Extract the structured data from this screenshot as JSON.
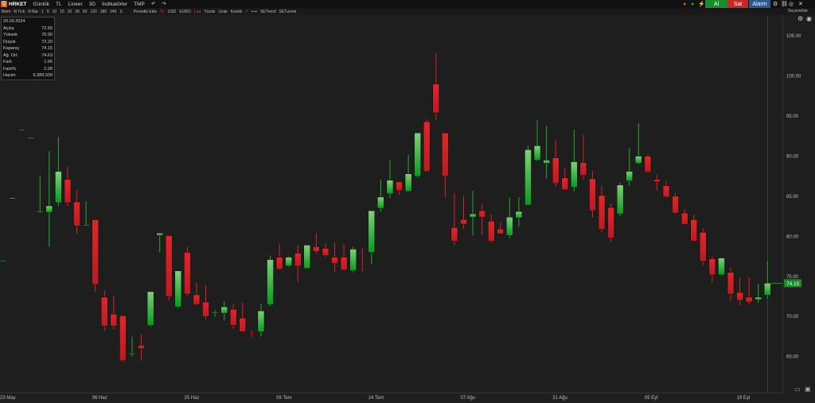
{
  "symbol": "HRKET",
  "toolbar": {
    "items": [
      "Günlük",
      "TL",
      "Lineer",
      "3D",
      "İndikatörler",
      "TMP"
    ],
    "sub_items": [
      "Birim",
      "N Tick",
      "N Bar",
      "1",
      "5",
      "10",
      "15",
      "20",
      "30",
      "60",
      "120",
      "180",
      "240",
      "S",
      "Periodik Ekle",
      "TL",
      "USD",
      "EURO",
      "Lira",
      "Yüzde",
      "Uzak",
      "Kesikli",
      "SETrend",
      "SETunnel"
    ],
    "buy": "Al",
    "sell": "Sat",
    "alarm": "Alarm",
    "right_label": "Seçenekler"
  },
  "info": {
    "date": "20.09.2024",
    "rows": [
      {
        "label": "Açılış",
        "value": "72.65"
      },
      {
        "label": "Yüksek",
        "value": "76.90"
      },
      {
        "label": "Düşük",
        "value": "72.20"
      },
      {
        "label": "Kapanış",
        "value": "74.15"
      },
      {
        "label": "Ağ. Ort",
        "value": "74.63"
      },
      {
        "label": "Fark",
        "value": "1.65"
      },
      {
        "label": "Fark%",
        "value": "2.28"
      },
      {
        "label": "Hacim",
        "value": "6,389,939"
      }
    ]
  },
  "colors": {
    "up": "#1fae2c",
    "down": "#d8232a",
    "bg": "#1e1e1e",
    "price_tag": "#1a8c2e"
  },
  "chart_data": {
    "type": "candlestick",
    "ylim": [
      60.5,
      107.5
    ],
    "y_ticks": [
      "105.00",
      "100.00",
      "95.00",
      "90.00",
      "85.00",
      "80.00",
      "75.00",
      "70.00",
      "65.00"
    ],
    "y_tick_values": [
      105,
      100,
      95,
      90,
      85,
      80,
      75,
      70,
      65
    ],
    "x_tick_labels": [
      "23 May",
      "06 Haz",
      "25 Haz",
      "09 Tem",
      "24 Tem",
      "07 Ağu",
      "21 Ağu",
      "05 Eyl",
      "19 Eyl"
    ],
    "x_tick_index": [
      0,
      10,
      20,
      30,
      40,
      50,
      60,
      70,
      80
    ],
    "last_price": "74.15",
    "candles": [
      {
        "o": 77.0,
        "h": 77.0,
        "l": 77.0,
        "c": 77.0
      },
      {
        "o": 84.8,
        "h": 84.8,
        "l": 84.8,
        "c": 84.8
      },
      {
        "o": 93.3,
        "h": 93.3,
        "l": 93.3,
        "c": 93.3
      },
      {
        "o": 92.3,
        "h": 92.3,
        "l": 92.3,
        "c": 92.3
      },
      {
        "o": 83.1,
        "h": 87.6,
        "l": 83.0,
        "c": 83.1
      },
      {
        "o": 83.0,
        "h": 90.6,
        "l": 78.7,
        "c": 83.8
      },
      {
        "o": 84.2,
        "h": 92.4,
        "l": 83.8,
        "c": 88.1
      },
      {
        "o": 87.1,
        "h": 88.7,
        "l": 83.8,
        "c": 84.2
      },
      {
        "o": 84.3,
        "h": 85.8,
        "l": 80.3,
        "c": 81.3
      },
      {
        "o": 81.4,
        "h": 84.4,
        "l": 81.3,
        "c": 81.4
      },
      {
        "o": 82.1,
        "h": 82.1,
        "l": 73.1,
        "c": 74.0
      },
      {
        "o": 72.4,
        "h": 73.3,
        "l": 68.2,
        "c": 68.8
      },
      {
        "o": 70.3,
        "h": 72.6,
        "l": 68.4,
        "c": 68.8
      },
      {
        "o": 70.1,
        "h": 70.1,
        "l": 64.4,
        "c": 64.5
      },
      {
        "o": 65.4,
        "h": 67.5,
        "l": 65.0,
        "c": 65.4
      },
      {
        "o": 66.4,
        "h": 67.8,
        "l": 64.5,
        "c": 66.0
      },
      {
        "o": 68.9,
        "h": 73.1,
        "l": 68.7,
        "c": 73.1
      },
      {
        "o": 80.1,
        "h": 80.3,
        "l": 78.0,
        "c": 80.4
      },
      {
        "o": 80.1,
        "h": 80.1,
        "l": 72.0,
        "c": 72.5
      },
      {
        "o": 71.2,
        "h": 75.7,
        "l": 71.0,
        "c": 75.7
      },
      {
        "o": 78.0,
        "h": 78.7,
        "l": 72.6,
        "c": 72.8
      },
      {
        "o": 72.7,
        "h": 74.2,
        "l": 71.5,
        "c": 71.5
      },
      {
        "o": 71.8,
        "h": 73.9,
        "l": 69.7,
        "c": 70.0
      },
      {
        "o": 70.4,
        "h": 70.8,
        "l": 70.0,
        "c": 70.5
      },
      {
        "o": 70.4,
        "h": 71.9,
        "l": 69.5,
        "c": 71.2
      },
      {
        "o": 70.9,
        "h": 71.5,
        "l": 68.5,
        "c": 68.9
      },
      {
        "o": 69.8,
        "h": 71.7,
        "l": 68.4,
        "c": 68.1
      },
      {
        "o": 67.9,
        "h": 68.3,
        "l": 67.4,
        "c": 67.8
      },
      {
        "o": 68.1,
        "h": 71.6,
        "l": 67.5,
        "c": 70.7
      },
      {
        "o": 71.5,
        "h": 77.6,
        "l": 71.3,
        "c": 77.1
      },
      {
        "o": 77.4,
        "h": 79.1,
        "l": 75.8,
        "c": 75.9
      },
      {
        "o": 76.3,
        "h": 77.5,
        "l": 76.2,
        "c": 77.4
      },
      {
        "o": 77.9,
        "h": 78.9,
        "l": 74.3,
        "c": 76.3
      },
      {
        "o": 76.0,
        "h": 78.9,
        "l": 76.0,
        "c": 78.9
      },
      {
        "o": 78.7,
        "h": 80.4,
        "l": 77.8,
        "c": 78.1
      },
      {
        "o": 78.5,
        "h": 79.1,
        "l": 77.4,
        "c": 77.6
      },
      {
        "o": 77.4,
        "h": 79.2,
        "l": 75.5,
        "c": 76.6
      },
      {
        "o": 77.4,
        "h": 79.0,
        "l": 75.9,
        "c": 75.8
      },
      {
        "o": 75.7,
        "h": 78.7,
        "l": 75.5,
        "c": 78.4
      },
      {
        "o": 76.1,
        "h": 78.5,
        "l": 75.6,
        "c": 76.0
      },
      {
        "o": 78.0,
        "h": 81.3,
        "l": 76.5,
        "c": 83.2
      },
      {
        "o": 83.5,
        "h": 87.1,
        "l": 83.1,
        "c": 84.9
      },
      {
        "o": 85.3,
        "h": 89.5,
        "l": 84.8,
        "c": 87.0
      },
      {
        "o": 86.8,
        "h": 86.8,
        "l": 85.2,
        "c": 85.7
      },
      {
        "o": 85.6,
        "h": 90.2,
        "l": 85.6,
        "c": 87.8
      },
      {
        "o": 87.5,
        "h": 91.6,
        "l": 87.3,
        "c": 92.9
      },
      {
        "o": 94.3,
        "h": 94.6,
        "l": 88.2,
        "c": 88.1
      },
      {
        "o": 99.0,
        "h": 102.9,
        "l": 94.5,
        "c": 95.4
      },
      {
        "o": 92.9,
        "h": 92.9,
        "l": 84.9,
        "c": 87.5
      },
      {
        "o": 81.1,
        "h": 85.4,
        "l": 78.9,
        "c": 79.4
      },
      {
        "o": 82.1,
        "h": 85.0,
        "l": 80.9,
        "c": 81.5
      },
      {
        "o": 82.4,
        "h": 85.7,
        "l": 80.1,
        "c": 82.8
      },
      {
        "o": 83.2,
        "h": 84.1,
        "l": 80.2,
        "c": 82.4
      },
      {
        "o": 81.9,
        "h": 82.8,
        "l": 79.2,
        "c": 79.4
      },
      {
        "o": 80.9,
        "h": 81.8,
        "l": 80.4,
        "c": 80.3
      },
      {
        "o": 80.1,
        "h": 84.8,
        "l": 79.8,
        "c": 82.4
      },
      {
        "o": 82.3,
        "h": 84.9,
        "l": 81.2,
        "c": 83.1
      },
      {
        "o": 83.9,
        "h": 91.3,
        "l": 83.9,
        "c": 90.8
      },
      {
        "o": 89.5,
        "h": 94.5,
        "l": 89.4,
        "c": 91.3
      },
      {
        "o": 89.1,
        "h": 93.8,
        "l": 87.2,
        "c": 89.5
      },
      {
        "o": 89.8,
        "h": 92.0,
        "l": 86.2,
        "c": 86.6
      },
      {
        "o": 87.3,
        "h": 88.6,
        "l": 85.8,
        "c": 85.8
      },
      {
        "o": 86.1,
        "h": 93.3,
        "l": 85.6,
        "c": 89.3
      },
      {
        "o": 89.2,
        "h": 92.7,
        "l": 87.1,
        "c": 87.6
      },
      {
        "o": 87.2,
        "h": 88.1,
        "l": 82.4,
        "c": 83.2
      },
      {
        "o": 85.1,
        "h": 86.3,
        "l": 80.5,
        "c": 80.9
      },
      {
        "o": 83.6,
        "h": 84.1,
        "l": 79.3,
        "c": 79.8
      },
      {
        "o": 82.8,
        "h": 86.7,
        "l": 82.5,
        "c": 86.4
      },
      {
        "o": 86.9,
        "h": 91.0,
        "l": 86.3,
        "c": 88.1
      },
      {
        "o": 89.1,
        "h": 94.1,
        "l": 89.0,
        "c": 90.0
      },
      {
        "o": 90.0,
        "h": 90.2,
        "l": 88.5,
        "c": 88.0
      },
      {
        "o": 87.1,
        "h": 87.7,
        "l": 85.7,
        "c": 86.8
      },
      {
        "o": 86.3,
        "h": 86.9,
        "l": 84.8,
        "c": 84.9
      },
      {
        "o": 85.0,
        "h": 85.4,
        "l": 82.8,
        "c": 82.9
      },
      {
        "o": 82.9,
        "h": 83.4,
        "l": 81.4,
        "c": 81.5
      },
      {
        "o": 82.1,
        "h": 82.7,
        "l": 79.7,
        "c": 79.4
      },
      {
        "o": 80.5,
        "h": 81.0,
        "l": 76.4,
        "c": 76.9
      },
      {
        "o": 77.2,
        "h": 77.5,
        "l": 74.2,
        "c": 75.2
      },
      {
        "o": 75.2,
        "h": 77.3,
        "l": 75.1,
        "c": 77.3
      },
      {
        "o": 75.5,
        "h": 76.1,
        "l": 71.9,
        "c": 72.8
      },
      {
        "o": 73.0,
        "h": 74.9,
        "l": 71.4,
        "c": 72.0
      },
      {
        "o": 72.4,
        "h": 74.9,
        "l": 71.5,
        "c": 71.8
      },
      {
        "o": 72.1,
        "h": 74.1,
        "l": 71.7,
        "c": 72.4
      },
      {
        "o": 72.65,
        "h": 76.9,
        "l": 72.2,
        "c": 74.15
      }
    ]
  }
}
